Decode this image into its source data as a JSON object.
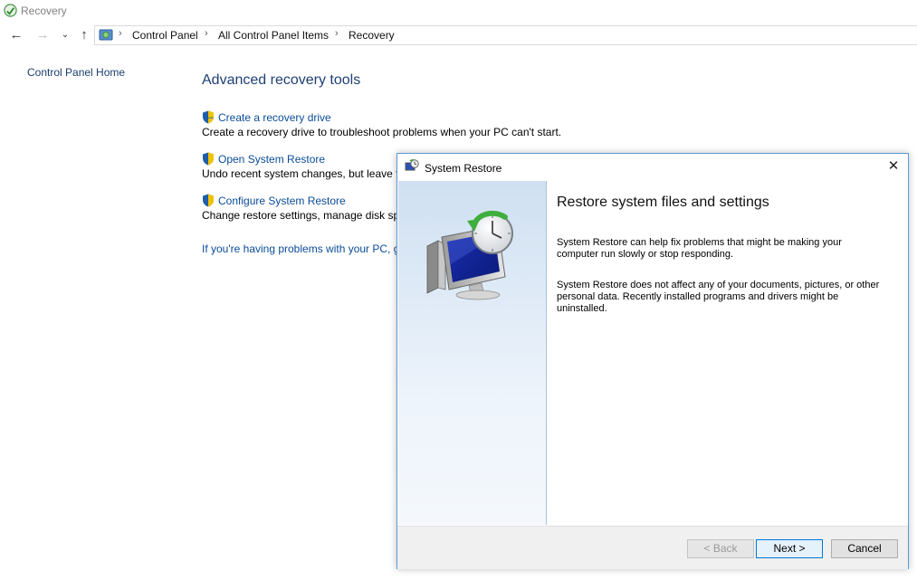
{
  "window": {
    "title": "Recovery"
  },
  "address": {
    "crumbs": [
      "Control Panel",
      "All Control Panel Items",
      "Recovery"
    ]
  },
  "left_pane": {
    "home_link": "Control Panel Home"
  },
  "main": {
    "heading": "Advanced recovery tools",
    "items": [
      {
        "link": "Create a recovery drive",
        "desc": "Create a recovery drive to troubleshoot problems when your PC can't start."
      },
      {
        "link": "Open System Restore",
        "desc": "Undo recent system changes, but leave fi"
      },
      {
        "link": "Configure System Restore",
        "desc": "Change restore settings, manage disk spa"
      }
    ],
    "problem_link": "If you're having problems with your PC, g"
  },
  "dialog": {
    "title": "System Restore",
    "close": "✕",
    "heading": "Restore system files and settings",
    "paragraphs": [
      "System Restore can help fix problems that might be making your computer run slowly or stop responding.",
      "System Restore does not affect any of your documents, pictures, or other personal data. Recently installed programs and drivers might be uninstalled."
    ],
    "buttons": {
      "back": "< Back",
      "next": "Next >",
      "cancel": "Cancel"
    }
  },
  "colors": {
    "link": "#0b4c98",
    "heading": "#1e3f74",
    "dialog_border": "#5d9bd5",
    "accent": "#0078d7"
  }
}
